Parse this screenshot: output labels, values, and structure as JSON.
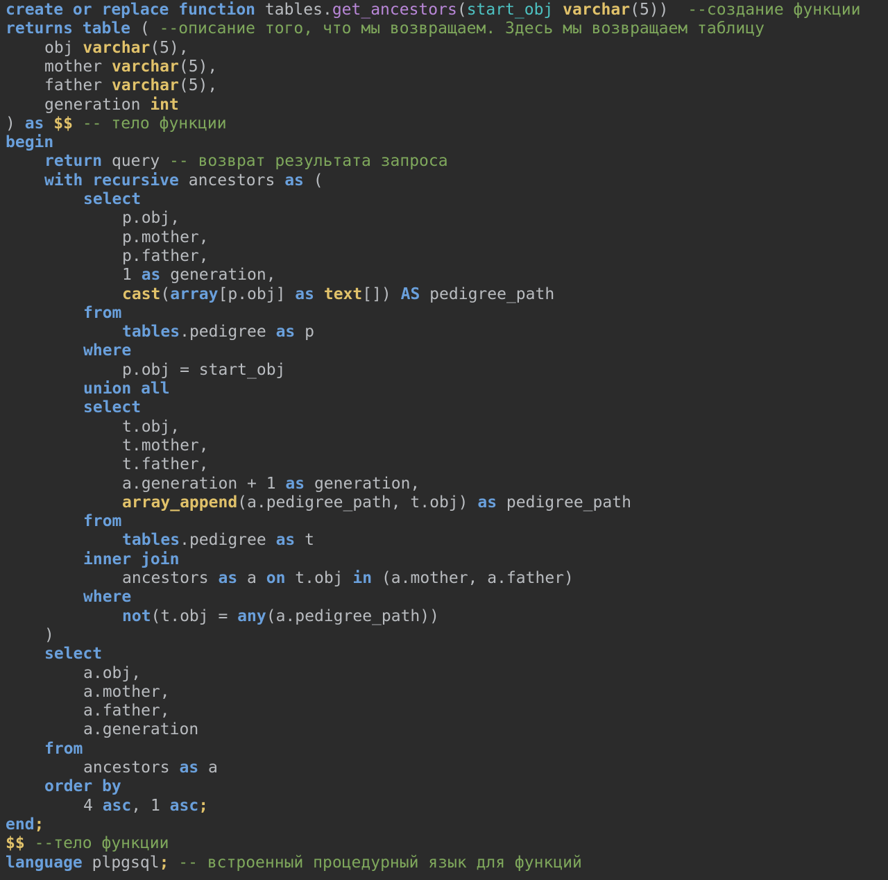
{
  "editor": {
    "language": "plpgsql",
    "colors": {
      "background": "#2b2b2b",
      "keyword": "#6aa0dc",
      "type": "#e1c26a",
      "function": "#b987d8",
      "parameter": "#4dc1c1",
      "comment": "#7fa85c",
      "text": "#b9bcc0"
    },
    "lines": [
      {
        "indent": 0,
        "tokens": [
          {
            "t": "kw",
            "v": "create or replace function "
          },
          {
            "t": "tx",
            "v": "tables."
          },
          {
            "t": "fn",
            "v": "get_ancestors"
          },
          {
            "t": "tx",
            "v": "("
          },
          {
            "t": "param",
            "v": "start_obj"
          },
          {
            "t": "tx",
            "v": " "
          },
          {
            "t": "type",
            "v": "varchar"
          },
          {
            "t": "tx",
            "v": "(5))  "
          },
          {
            "t": "cm",
            "v": "--создание функции"
          }
        ]
      },
      {
        "indent": 0,
        "tokens": [
          {
            "t": "kw",
            "v": "returns table"
          },
          {
            "t": "tx",
            "v": " ( "
          },
          {
            "t": "cm",
            "v": "--описание того, что мы возвращаем. Здесь мы возвращаем таблицу"
          }
        ]
      },
      {
        "indent": 1,
        "tokens": [
          {
            "t": "tx",
            "v": "obj "
          },
          {
            "t": "type",
            "v": "varchar"
          },
          {
            "t": "tx",
            "v": "(5),"
          }
        ]
      },
      {
        "indent": 1,
        "tokens": [
          {
            "t": "tx",
            "v": "mother "
          },
          {
            "t": "type",
            "v": "varchar"
          },
          {
            "t": "tx",
            "v": "(5),"
          }
        ]
      },
      {
        "indent": 1,
        "tokens": [
          {
            "t": "tx",
            "v": "father "
          },
          {
            "t": "type",
            "v": "varchar"
          },
          {
            "t": "tx",
            "v": "(5),"
          }
        ]
      },
      {
        "indent": 1,
        "tokens": [
          {
            "t": "tx",
            "v": "generation "
          },
          {
            "t": "type",
            "v": "int"
          }
        ]
      },
      {
        "indent": 0,
        "tokens": [
          {
            "t": "tx",
            "v": ") "
          },
          {
            "t": "kw",
            "v": "as"
          },
          {
            "t": "tx",
            "v": " "
          },
          {
            "t": "type",
            "v": "$$"
          },
          {
            "t": "tx",
            "v": " "
          },
          {
            "t": "cm",
            "v": "-- тело функции"
          }
        ]
      },
      {
        "indent": 0,
        "tokens": [
          {
            "t": "kw",
            "v": "begin"
          }
        ]
      },
      {
        "indent": 1,
        "tokens": [
          {
            "t": "kw",
            "v": "return"
          },
          {
            "t": "tx",
            "v": " query "
          },
          {
            "t": "cm",
            "v": "-- возврат результата запроса"
          }
        ]
      },
      {
        "indent": 1,
        "tokens": [
          {
            "t": "kw",
            "v": "with recursive"
          },
          {
            "t": "tx",
            "v": " ancestors "
          },
          {
            "t": "kw",
            "v": "as"
          },
          {
            "t": "tx",
            "v": " ("
          }
        ]
      },
      {
        "indent": 2,
        "tokens": [
          {
            "t": "kw",
            "v": "select"
          }
        ]
      },
      {
        "indent": 3,
        "tokens": [
          {
            "t": "tx",
            "v": "p.obj,"
          }
        ]
      },
      {
        "indent": 3,
        "tokens": [
          {
            "t": "tx",
            "v": "p.mother,"
          }
        ]
      },
      {
        "indent": 3,
        "tokens": [
          {
            "t": "tx",
            "v": "p.father,"
          }
        ]
      },
      {
        "indent": 3,
        "tokens": [
          {
            "t": "tx",
            "v": "1 "
          },
          {
            "t": "kw",
            "v": "as"
          },
          {
            "t": "tx",
            "v": " generation,"
          }
        ]
      },
      {
        "indent": 3,
        "tokens": [
          {
            "t": "type",
            "v": "cast"
          },
          {
            "t": "tx",
            "v": "("
          },
          {
            "t": "kw",
            "v": "array"
          },
          {
            "t": "tx",
            "v": "[p.obj] "
          },
          {
            "t": "kw",
            "v": "as"
          },
          {
            "t": "tx",
            "v": " "
          },
          {
            "t": "type",
            "v": "text"
          },
          {
            "t": "tx",
            "v": "[]) "
          },
          {
            "t": "kw",
            "v": "AS"
          },
          {
            "t": "tx",
            "v": " pedigree_path"
          }
        ]
      },
      {
        "indent": 2,
        "tokens": [
          {
            "t": "kw",
            "v": "from"
          }
        ]
      },
      {
        "indent": 3,
        "tokens": [
          {
            "t": "kw",
            "v": "tables"
          },
          {
            "t": "tx",
            "v": ".pedigree "
          },
          {
            "t": "kw",
            "v": "as"
          },
          {
            "t": "tx",
            "v": " p"
          }
        ]
      },
      {
        "indent": 2,
        "tokens": [
          {
            "t": "kw",
            "v": "where"
          }
        ]
      },
      {
        "indent": 3,
        "tokens": [
          {
            "t": "tx",
            "v": "p.obj = start_obj"
          }
        ]
      },
      {
        "indent": 2,
        "tokens": [
          {
            "t": "kw",
            "v": "union all"
          }
        ]
      },
      {
        "indent": 2,
        "tokens": [
          {
            "t": "kw",
            "v": "select"
          }
        ]
      },
      {
        "indent": 3,
        "tokens": [
          {
            "t": "tx",
            "v": "t.obj,"
          }
        ]
      },
      {
        "indent": 3,
        "tokens": [
          {
            "t": "tx",
            "v": "t.mother,"
          }
        ]
      },
      {
        "indent": 3,
        "tokens": [
          {
            "t": "tx",
            "v": "t.father,"
          }
        ]
      },
      {
        "indent": 3,
        "tokens": [
          {
            "t": "tx",
            "v": "a.generation + 1 "
          },
          {
            "t": "kw",
            "v": "as"
          },
          {
            "t": "tx",
            "v": " generation,"
          }
        ]
      },
      {
        "indent": 3,
        "tokens": [
          {
            "t": "type",
            "v": "array_append"
          },
          {
            "t": "tx",
            "v": "(a.pedigree_path, t.obj) "
          },
          {
            "t": "kw",
            "v": "as"
          },
          {
            "t": "tx",
            "v": " pedigree_path"
          }
        ]
      },
      {
        "indent": 2,
        "tokens": [
          {
            "t": "kw",
            "v": "from"
          }
        ]
      },
      {
        "indent": 3,
        "tokens": [
          {
            "t": "kw",
            "v": "tables"
          },
          {
            "t": "tx",
            "v": ".pedigree "
          },
          {
            "t": "kw",
            "v": "as"
          },
          {
            "t": "tx",
            "v": " t"
          }
        ]
      },
      {
        "indent": 2,
        "tokens": [
          {
            "t": "kw",
            "v": "inner join"
          }
        ]
      },
      {
        "indent": 3,
        "tokens": [
          {
            "t": "tx",
            "v": "ancestors "
          },
          {
            "t": "kw",
            "v": "as"
          },
          {
            "t": "tx",
            "v": " a "
          },
          {
            "t": "kw",
            "v": "on"
          },
          {
            "t": "tx",
            "v": " t.obj "
          },
          {
            "t": "kw",
            "v": "in"
          },
          {
            "t": "tx",
            "v": " (a.mother, a.father)"
          }
        ]
      },
      {
        "indent": 2,
        "tokens": [
          {
            "t": "kw",
            "v": "where"
          }
        ]
      },
      {
        "indent": 3,
        "tokens": [
          {
            "t": "kw",
            "v": "not"
          },
          {
            "t": "tx",
            "v": "(t.obj = "
          },
          {
            "t": "kw",
            "v": "any"
          },
          {
            "t": "tx",
            "v": "(a.pedigree_path))"
          }
        ]
      },
      {
        "indent": 1,
        "tokens": [
          {
            "t": "tx",
            "v": ")"
          }
        ]
      },
      {
        "indent": 1,
        "tokens": [
          {
            "t": "kw",
            "v": "select"
          }
        ]
      },
      {
        "indent": 2,
        "tokens": [
          {
            "t": "tx",
            "v": "a.obj,"
          }
        ]
      },
      {
        "indent": 2,
        "tokens": [
          {
            "t": "tx",
            "v": "a.mother,"
          }
        ]
      },
      {
        "indent": 2,
        "tokens": [
          {
            "t": "tx",
            "v": "a.father,"
          }
        ]
      },
      {
        "indent": 2,
        "tokens": [
          {
            "t": "tx",
            "v": "a.generation"
          }
        ]
      },
      {
        "indent": 1,
        "tokens": [
          {
            "t": "kw",
            "v": "from"
          }
        ]
      },
      {
        "indent": 2,
        "tokens": [
          {
            "t": "tx",
            "v": "ancestors "
          },
          {
            "t": "kw",
            "v": "as"
          },
          {
            "t": "tx",
            "v": " a"
          }
        ]
      },
      {
        "indent": 1,
        "tokens": [
          {
            "t": "kw",
            "v": "order by"
          }
        ]
      },
      {
        "indent": 2,
        "tokens": [
          {
            "t": "tx",
            "v": "4 "
          },
          {
            "t": "kw",
            "v": "asc"
          },
          {
            "t": "tx",
            "v": ", 1 "
          },
          {
            "t": "kw",
            "v": "asc"
          },
          {
            "t": "type",
            "v": ";"
          }
        ]
      },
      {
        "indent": 0,
        "tokens": [
          {
            "t": "kw",
            "v": "end"
          },
          {
            "t": "type",
            "v": ";"
          }
        ]
      },
      {
        "indent": 0,
        "tokens": [
          {
            "t": "type",
            "v": "$$"
          },
          {
            "t": "tx",
            "v": " "
          },
          {
            "t": "cm",
            "v": "--тело функции"
          }
        ]
      },
      {
        "indent": 0,
        "tokens": [
          {
            "t": "kw",
            "v": "language"
          },
          {
            "t": "tx",
            "v": " plpgsql"
          },
          {
            "t": "type",
            "v": ";"
          },
          {
            "t": "tx",
            "v": " "
          },
          {
            "t": "cm",
            "v": "-- встроенный процедурный язык для функций"
          }
        ]
      }
    ]
  }
}
